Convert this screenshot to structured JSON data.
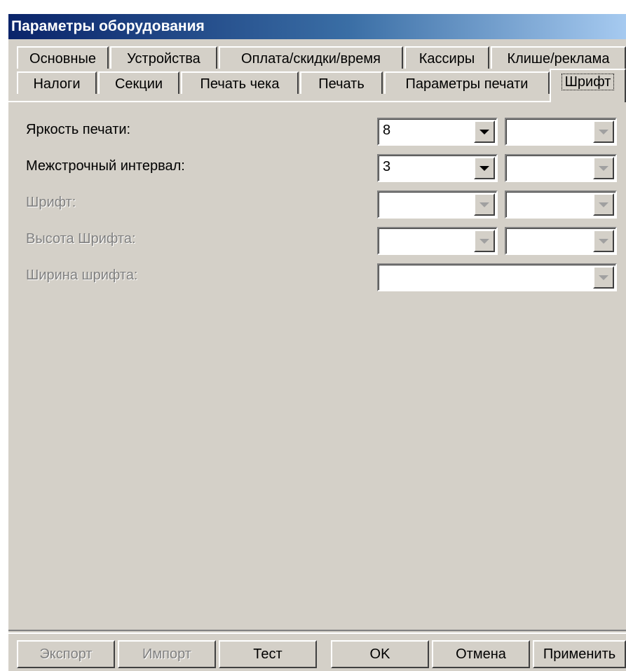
{
  "window": {
    "title": "Параметры оборудования"
  },
  "tabs": {
    "row1": [
      "Основные",
      "Устройства",
      "Оплата/скидки/время",
      "Кассиры",
      "Клише/реклама"
    ],
    "row2": [
      "Налоги",
      "Секции",
      "Печать чека",
      "Печать",
      "Параметры печати",
      "Шрифт"
    ],
    "active": "Шрифт"
  },
  "fields": {
    "brightness": {
      "label": "Яркость печати:",
      "value": "8",
      "value2": ""
    },
    "line_spacing": {
      "label": "Межстрочный интервал:",
      "value": "3",
      "value2": ""
    },
    "font": {
      "label": "Шрифт:",
      "value": "",
      "value2": ""
    },
    "font_height": {
      "label": "Высота Шрифта:",
      "value": "",
      "value2": ""
    },
    "font_width": {
      "label": "Ширина шрифта:",
      "value": ""
    }
  },
  "buttons": {
    "export": "Экспорт",
    "import": "Импорт",
    "test": "Тест",
    "ok": "OK",
    "cancel": "Отмена",
    "apply": "Применить"
  },
  "colors": {
    "titlebar_start": "#0a246a",
    "titlebar_end": "#a6caf0",
    "face": "#d4d0c8"
  }
}
